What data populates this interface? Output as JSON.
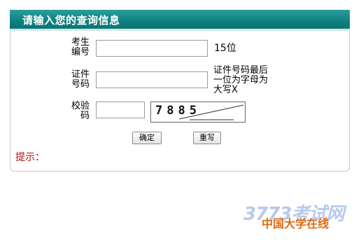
{
  "header": {
    "title": "请输入您的查询信息"
  },
  "form": {
    "exam_no": {
      "label_line1": "考生",
      "label_line2": "编号",
      "value": "",
      "hint": "15位"
    },
    "id_no": {
      "label_line1": "证件",
      "label_line2": "号码",
      "value": "",
      "hint_line1": "证件号码最后",
      "hint_line2": "一位为字母为",
      "hint_line3": "大写X"
    },
    "captcha": {
      "label_line1": "校验",
      "label_line2": "码",
      "value": "",
      "image_text": "7885"
    },
    "submit_label": "确定",
    "reset_label": "重写",
    "tip_label": "提示："
  },
  "watermark": {
    "top": "3773考试网",
    "bottom": "中国大学在线"
  }
}
